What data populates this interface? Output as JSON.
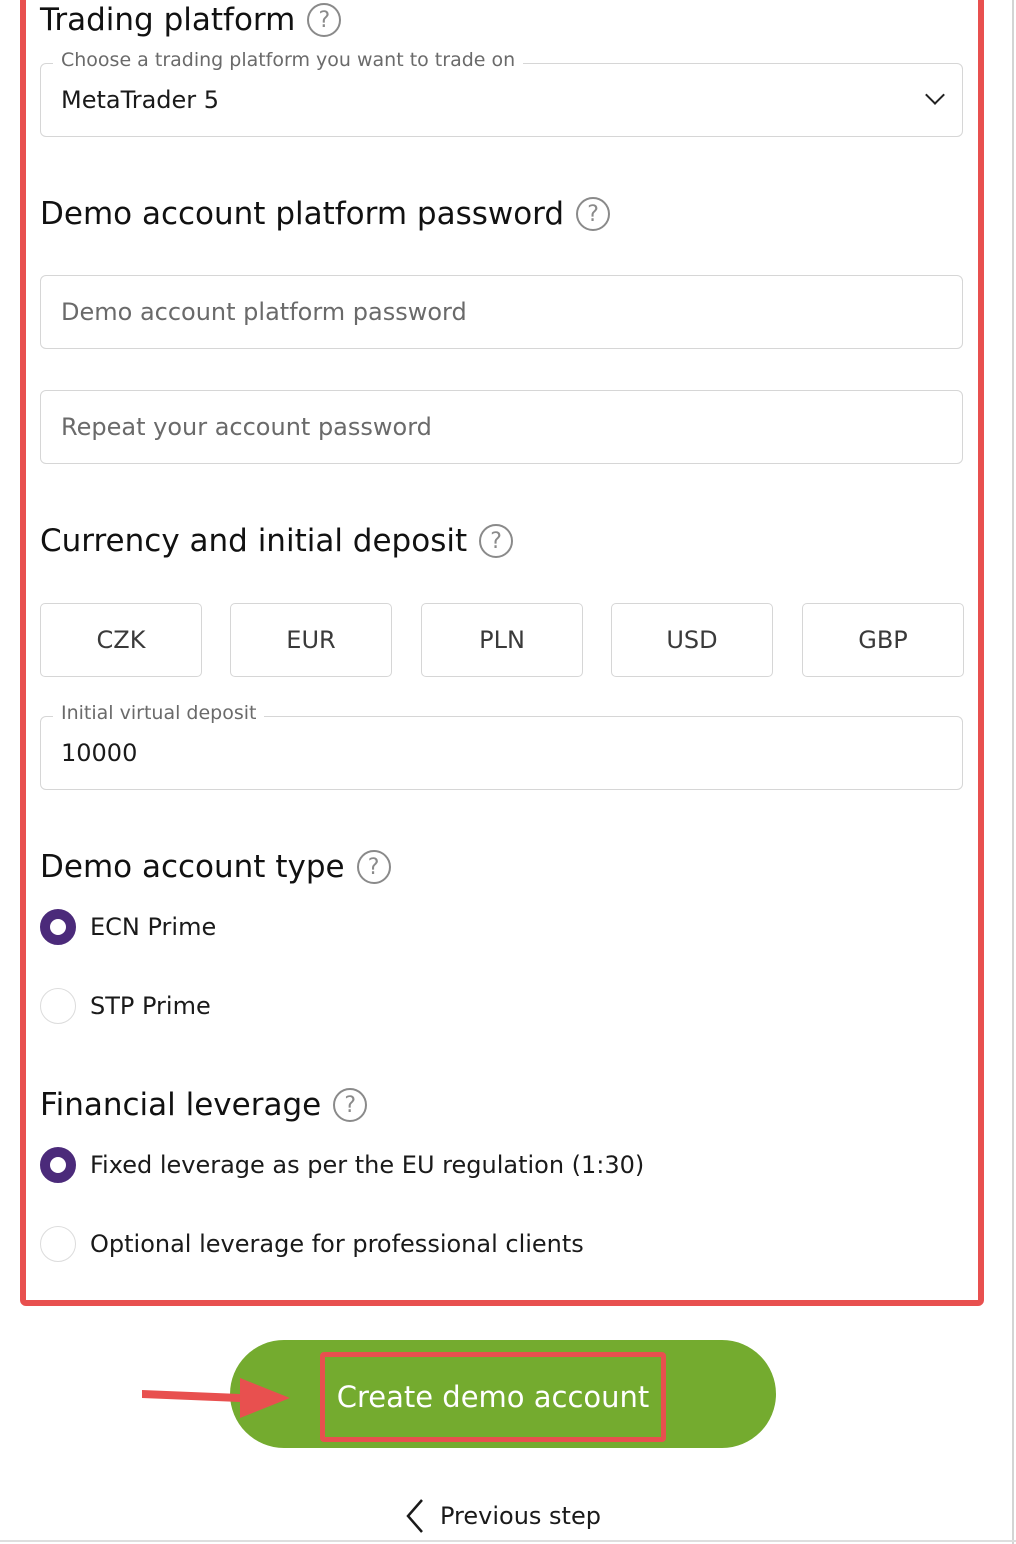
{
  "trading_platform": {
    "title": "Trading platform",
    "select_legend": "Choose a trading platform you want to trade on",
    "selected": "MetaTrader 5"
  },
  "password": {
    "title": "Demo account platform password",
    "password_placeholder": "Demo account platform password",
    "repeat_placeholder": "Repeat your account password"
  },
  "currency": {
    "title": "Currency and initial deposit",
    "options": [
      "CZK",
      "EUR",
      "PLN",
      "USD",
      "GBP"
    ],
    "deposit_legend": "Initial virtual deposit",
    "deposit_value": "10000"
  },
  "account_type": {
    "title": "Demo account type",
    "options": [
      {
        "label": "ECN Prime",
        "checked": true
      },
      {
        "label": "STP Prime",
        "checked": false
      }
    ]
  },
  "leverage": {
    "title": "Financial leverage",
    "options": [
      {
        "label": "Fixed leverage as per the EU regulation (1:30)",
        "checked": true
      },
      {
        "label": "Optional leverage for professional clients",
        "checked": false
      }
    ]
  },
  "actions": {
    "create_label": "Create demo account",
    "previous_label": "Previous step"
  },
  "colors": {
    "accent_green": "#74ab2f",
    "radio_purple": "#4b2a7a",
    "highlight_red": "#e8504f"
  },
  "icons": {
    "help": "question-circle-icon",
    "chevron": "chevron-down-icon",
    "back": "chevron-left-icon",
    "pointer": "arrow-right-icon"
  }
}
